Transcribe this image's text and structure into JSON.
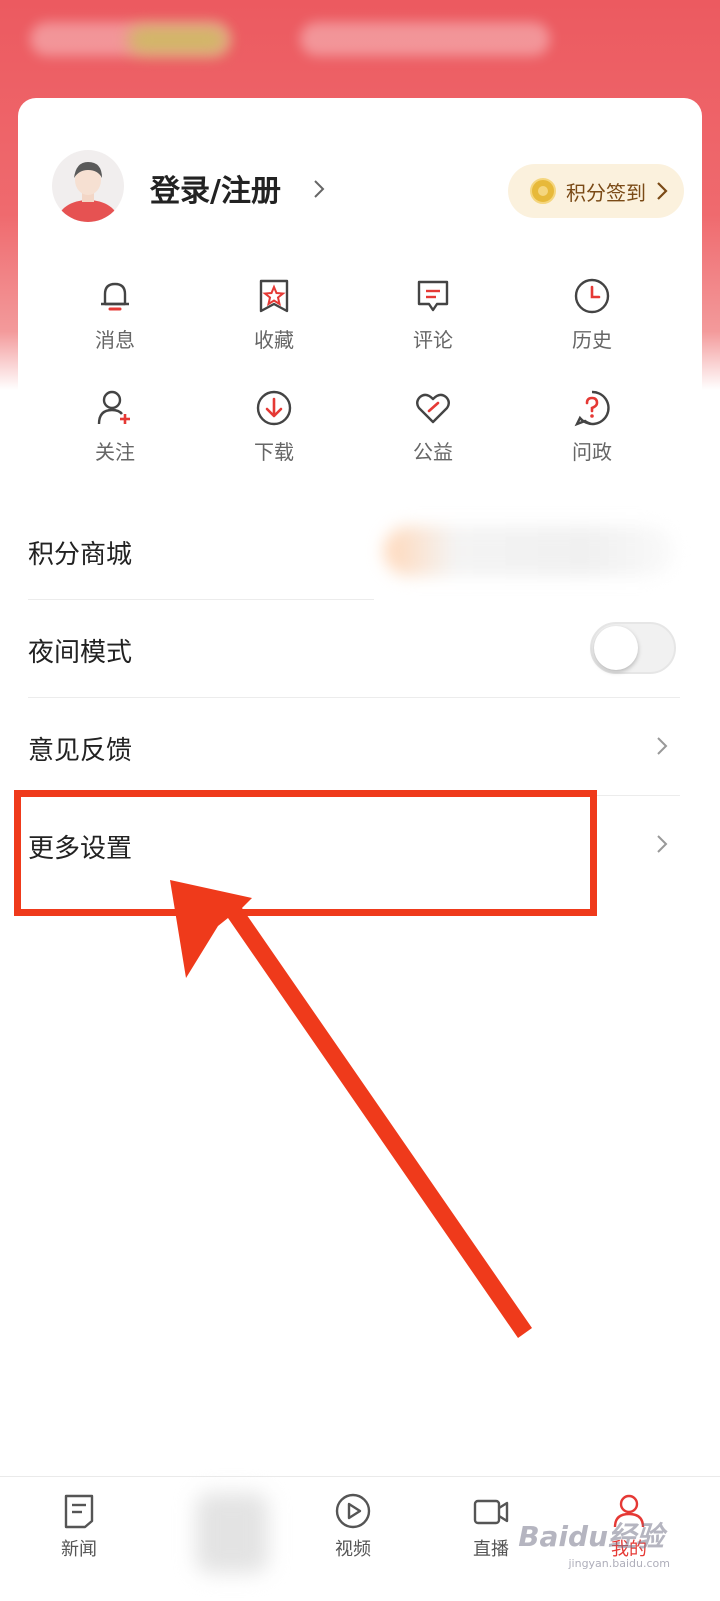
{
  "profile": {
    "login_label": "登录/注册",
    "signin_label": "积分签到"
  },
  "grid": [
    {
      "label": "消息",
      "icon": "bell-icon"
    },
    {
      "label": "收藏",
      "icon": "star-icon"
    },
    {
      "label": "评论",
      "icon": "comment-icon"
    },
    {
      "label": "历史",
      "icon": "clock-icon"
    },
    {
      "label": "关注",
      "icon": "add-user-icon"
    },
    {
      "label": "下载",
      "icon": "download-icon"
    },
    {
      "label": "公益",
      "icon": "charity-heart-icon"
    },
    {
      "label": "问政",
      "icon": "question-icon"
    }
  ],
  "menu": {
    "points_mall": "积分商城",
    "night_mode": "夜间模式",
    "night_mode_on": false,
    "feedback": "意见反馈",
    "more_settings": "更多设置"
  },
  "nav": [
    {
      "label": "新闻",
      "icon": "news-icon",
      "active": false
    },
    {
      "label": "视频",
      "icon": "video-play-icon",
      "active": false
    },
    {
      "label": "直播",
      "icon": "live-camera-icon",
      "active": false
    },
    {
      "label": "我的",
      "icon": "profile-icon",
      "active": true
    }
  ],
  "watermark": {
    "text": "Baidu经验",
    "sub": "jingyan.baidu.com"
  },
  "colors": {
    "brand_red": "#ec5a60",
    "annotation_red": "#ef3a1b",
    "active_tab": "#e53935"
  }
}
